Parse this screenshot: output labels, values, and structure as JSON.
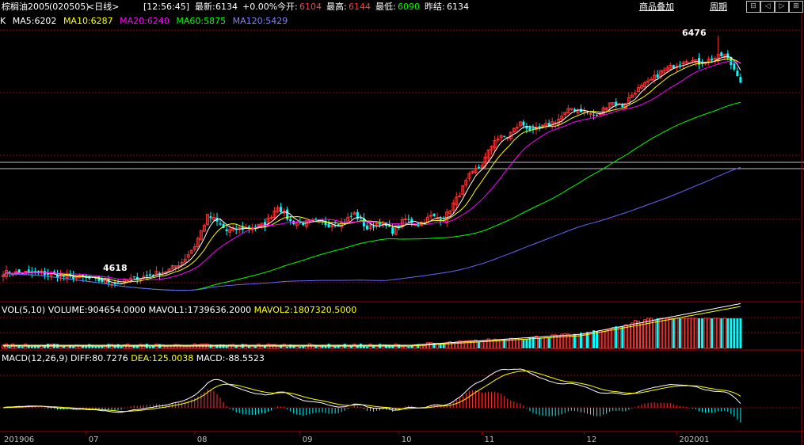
{
  "header": {
    "symbol": "棕榈油2005",
    "code": "(020505)",
    "period": "<日线>",
    "time": "[12:56:45]",
    "latest_label": "最新:",
    "latest_value": "6134",
    "change": "+0.00%",
    "open_label": "今开:",
    "open_value": "6104",
    "high_label": "最高:",
    "high_value": "6144",
    "low_label": "最低:",
    "low_value": "6090",
    "prev_label": "昨结:",
    "prev_value": "6134",
    "add_product": "商品叠加",
    "cycle": "周期",
    "buttons": [
      "⊟",
      "◁",
      "▷",
      "⊞"
    ]
  },
  "price_legend": {
    "k": "K",
    "ma5": "MA5:6202",
    "ma10": "MA10:6287",
    "ma20": "MA20:6240",
    "ma60": "MA60:5875",
    "ma120": "MA120:5429"
  },
  "price_annotations": {
    "high": "6476",
    "low": "4618"
  },
  "volume_legend": {
    "name": "VOL(5,10)",
    "volume": "VOLUME:904654.0000",
    "mavol1": "MAVOL1:1739636.2000",
    "mavol2": "MAVOL2:1807320.5000"
  },
  "macd_legend": {
    "name": "MACD(12,26,9)",
    "diff": "DIFF:80.7276",
    "dea": "DEA:125.0038",
    "macd": "MACD:-88.5523"
  },
  "colors": {
    "up": "#ff3232",
    "down": "#00ffff",
    "ma5": "#ffffff",
    "ma10": "#ffff00",
    "ma20": "#ff00ff",
    "ma60": "#00ff00",
    "ma120": "#6464ff",
    "grid": "#a00000"
  },
  "chart_data": {
    "type": "candlestick",
    "x_labels": [
      "201906",
      "07",
      "08",
      "09",
      "10",
      "11",
      "12",
      "202001"
    ],
    "price_range": [
      4500,
      6600
    ],
    "anchors": [
      [
        0,
        4700
      ],
      [
        10,
        4700
      ],
      [
        20,
        4670
      ],
      [
        25,
        4660
      ],
      [
        30,
        4640
      ],
      [
        36,
        4618
      ],
      [
        40,
        4650
      ],
      [
        46,
        4680
      ],
      [
        52,
        4720
      ],
      [
        56,
        4780
      ],
      [
        60,
        4900
      ],
      [
        64,
        5120
      ],
      [
        66,
        5100
      ],
      [
        70,
        5010
      ],
      [
        74,
        5030
      ],
      [
        78,
        5040
      ],
      [
        82,
        5060
      ],
      [
        86,
        5200
      ],
      [
        90,
        5080
      ],
      [
        94,
        5070
      ],
      [
        98,
        5080
      ],
      [
        102,
        5060
      ],
      [
        106,
        5070
      ],
      [
        110,
        5140
      ],
      [
        114,
        5030
      ],
      [
        118,
        5080
      ],
      [
        122,
        5010
      ],
      [
        126,
        5100
      ],
      [
        130,
        5060
      ],
      [
        134,
        5120
      ],
      [
        138,
        5100
      ],
      [
        142,
        5250
      ],
      [
        146,
        5420
      ],
      [
        150,
        5510
      ],
      [
        154,
        5700
      ],
      [
        158,
        5720
      ],
      [
        162,
        5820
      ],
      [
        166,
        5760
      ],
      [
        170,
        5800
      ],
      [
        174,
        5850
      ],
      [
        178,
        5930
      ],
      [
        182,
        5910
      ],
      [
        186,
        5870
      ],
      [
        190,
        5980
      ],
      [
        194,
        5950
      ],
      [
        198,
        6060
      ],
      [
        202,
        6120
      ],
      [
        206,
        6200
      ],
      [
        210,
        6250
      ],
      [
        214,
        6300
      ],
      [
        218,
        6270
      ],
      [
        222,
        6300
      ],
      [
        226,
        6330
      ],
      [
        230,
        6190
      ],
      [
        231,
        6134
      ]
    ],
    "high_point": {
      "index": 224,
      "value": 6476
    },
    "low_point": {
      "index": 36,
      "value": 4618
    }
  }
}
